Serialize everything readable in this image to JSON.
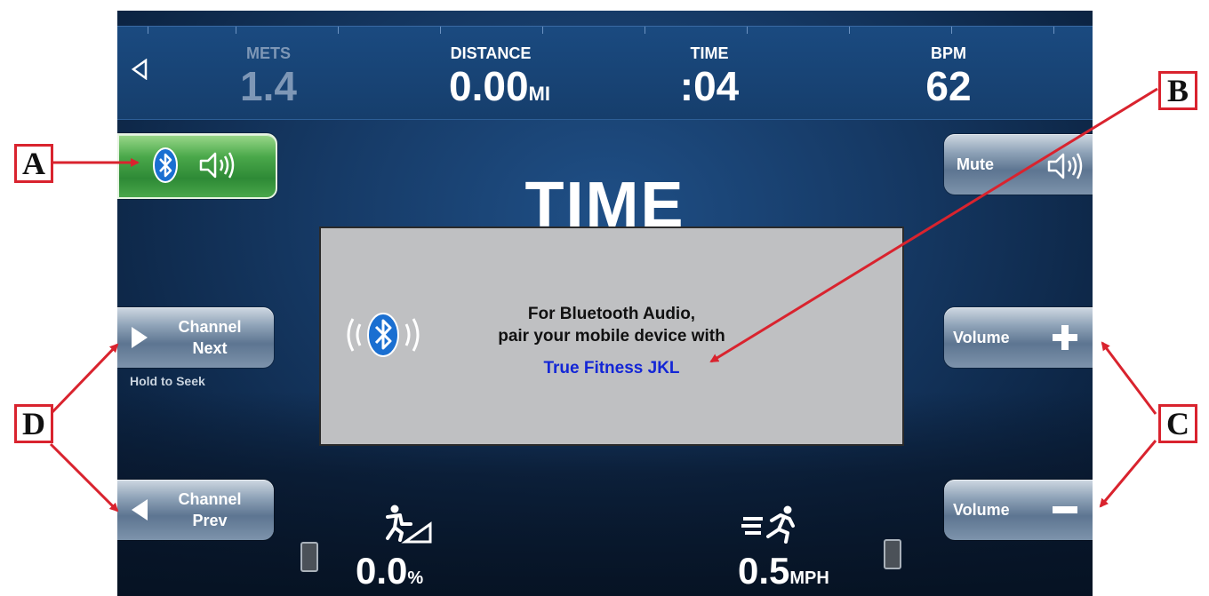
{
  "topbar": {
    "stats": [
      {
        "label": "METS",
        "value": "1.4",
        "unit": ""
      },
      {
        "label": "DISTANCE",
        "value": "0.00",
        "unit": "MI"
      },
      {
        "label": "TIME",
        "value": ":04",
        "unit": ""
      },
      {
        "label": "BPM",
        "value": "62",
        "unit": ""
      }
    ]
  },
  "main": {
    "title": "TIME"
  },
  "buttons": {
    "mute": "Mute",
    "channel_next": [
      "Channel",
      "Next"
    ],
    "channel_prev": [
      "Channel",
      "Prev"
    ],
    "hold_to_seek": "Hold to Seek",
    "volume_up": "Volume",
    "volume_down": "Volume"
  },
  "dialog": {
    "line1": "For Bluetooth Audio,",
    "line2": "pair your mobile device with",
    "device_name": "True Fitness JKL"
  },
  "bottom": {
    "incline_value": "0.0",
    "incline_unit": "%",
    "speed_value": "0.5",
    "speed_unit": "MPH"
  },
  "callouts": {
    "a": "A",
    "b": "B",
    "c": "C",
    "d": "D"
  },
  "colors": {
    "callout_red": "#d9232e",
    "device_name_blue": "#1326d6",
    "bluetooth_blue": "#1a6fd1",
    "active_green": "#3e9c44"
  },
  "icons": [
    "back-icon",
    "bluetooth-icon",
    "speaker-icon",
    "play-right-icon",
    "play-left-icon",
    "plus-icon",
    "minus-icon",
    "incline-walker-icon",
    "speed-runner-icon",
    "remote-icon"
  ]
}
